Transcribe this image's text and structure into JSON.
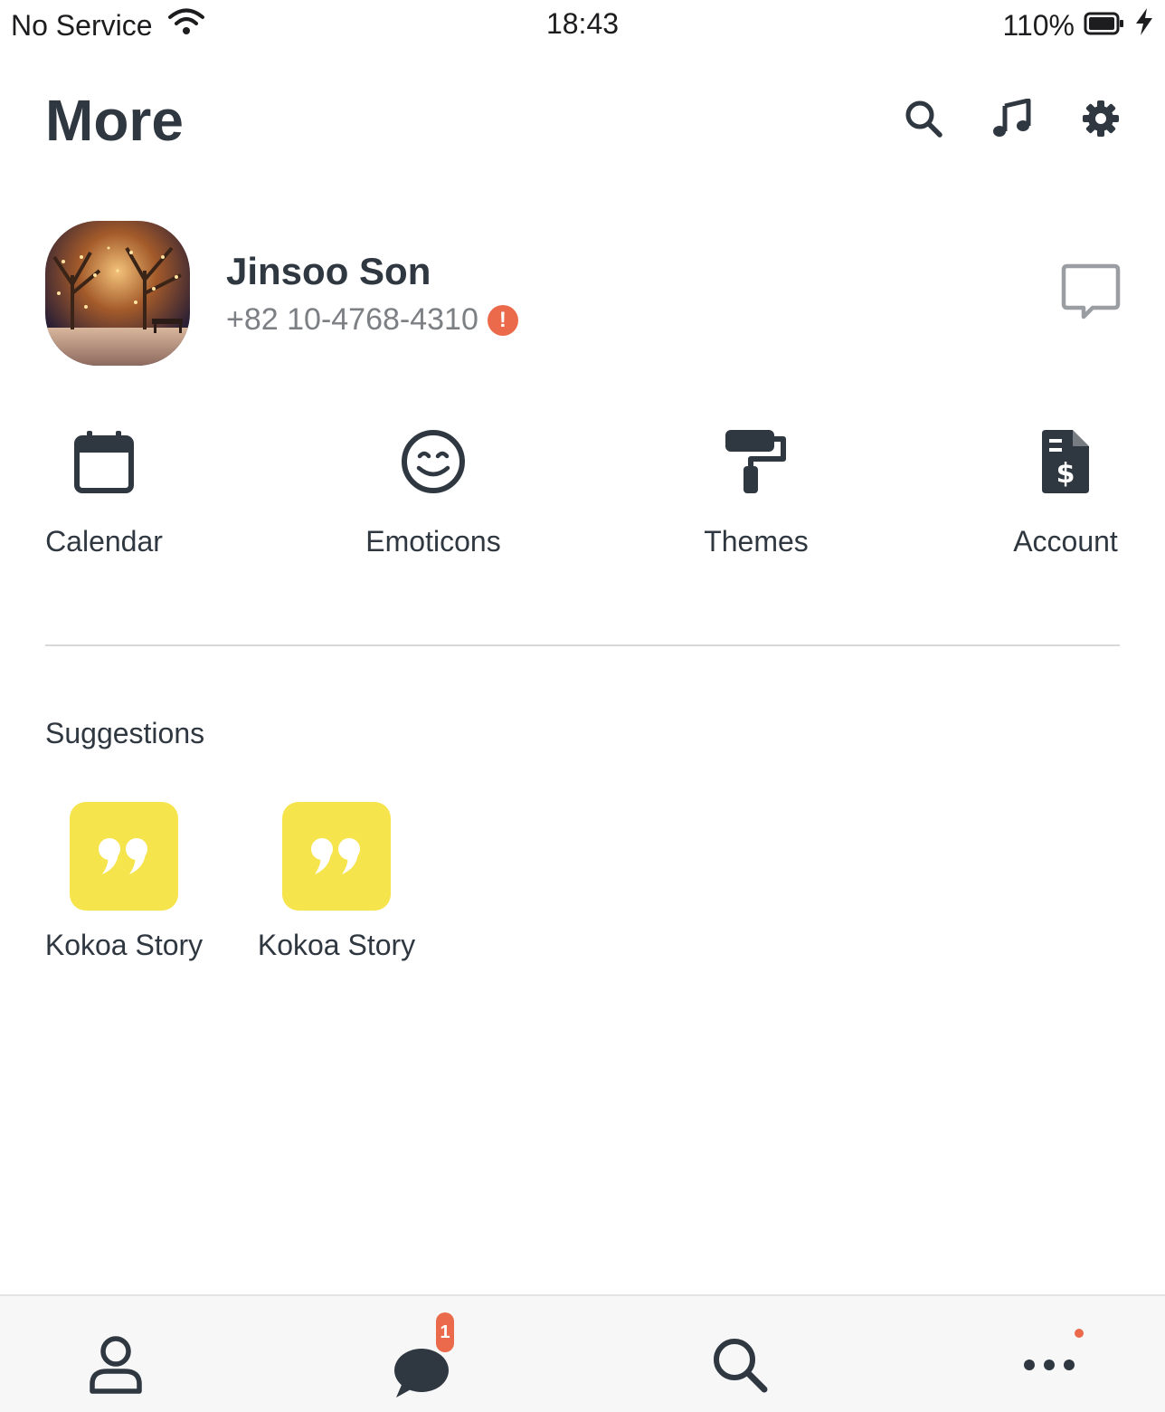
{
  "status_bar": {
    "carrier": "No Service",
    "time": "18:43",
    "battery": "110%"
  },
  "header": {
    "title": "More",
    "icons": [
      "search-icon",
      "music-note-icon",
      "gear-icon"
    ]
  },
  "profile": {
    "name": "Jinsoo Son",
    "phone": "+82 10-4768-4310",
    "warning_badge": "!"
  },
  "quick_actions": [
    {
      "label": "Calendar",
      "icon": "calendar-icon"
    },
    {
      "label": "Emoticons",
      "icon": "smile-icon"
    },
    {
      "label": "Themes",
      "icon": "paint-roller-icon"
    },
    {
      "label": "Account",
      "icon": "invoice-dollar-icon"
    }
  ],
  "suggestions": {
    "title": "Suggestions",
    "items": [
      {
        "label": "Kokoa Story",
        "icon": "quote-icon"
      },
      {
        "label": "Kokoa Story",
        "icon": "quote-icon"
      }
    ]
  },
  "bottom_nav": {
    "items": [
      "person-icon",
      "chat-bubble-icon",
      "search-icon",
      "more-dots-icon"
    ],
    "chat_badge": "1"
  },
  "colors": {
    "text": "#2f3740",
    "accent_yellow": "#f6e44d",
    "badge_red": "#ec6a4c",
    "secondary_text": "#7c7f83"
  }
}
